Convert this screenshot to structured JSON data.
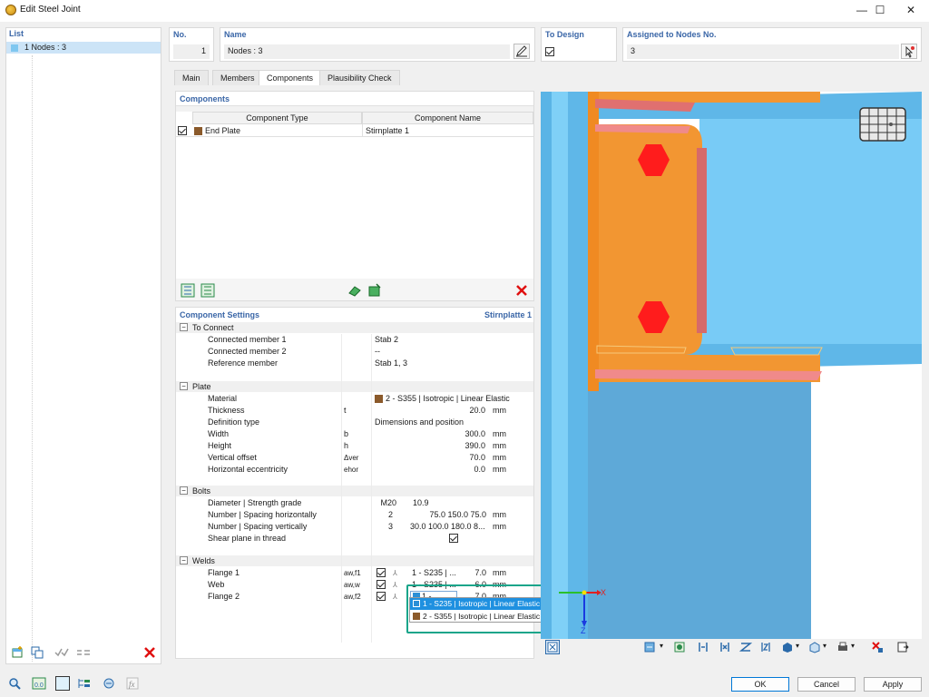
{
  "window": {
    "title": "Edit Steel Joint",
    "controls": {
      "minimize": "—",
      "maximize": "☐",
      "close": "✕"
    }
  },
  "list": {
    "header": "List",
    "items": [
      {
        "label": "1  Nodes : 3"
      }
    ]
  },
  "header": {
    "no_label": "No.",
    "no_value": "1",
    "name_label": "Name",
    "name_value": "Nodes : 3",
    "to_design_label": "To Design",
    "to_design_checked": true,
    "assigned_label": "Assigned to Nodes No.",
    "assigned_value": "3"
  },
  "tabs": [
    {
      "label": "Main",
      "active": false
    },
    {
      "label": "Members",
      "active": false
    },
    {
      "label": "Components",
      "active": true
    },
    {
      "label": "Plausibility Check",
      "active": false
    }
  ],
  "components": {
    "section_title": "Components",
    "col_type": "Component Type",
    "col_name": "Component Name",
    "rows": [
      {
        "checked": true,
        "type": "End Plate",
        "name": "Stirnplatte 1",
        "color": "#8b5a2b"
      }
    ]
  },
  "settings": {
    "section_title": "Component Settings",
    "component_name": "Stirnplatte 1",
    "groups": {
      "to_connect": {
        "title": "To Connect",
        "rows": [
          {
            "label": "Connected member 1",
            "sym": "",
            "value": "Stab 2",
            "unit": ""
          },
          {
            "label": "Connected member 2",
            "sym": "",
            "value": "--",
            "unit": ""
          },
          {
            "label": "Reference member",
            "sym": "",
            "value": "Stab 1, 3",
            "unit": ""
          }
        ]
      },
      "plate": {
        "title": "Plate",
        "rows": [
          {
            "label": "Material",
            "sym": "",
            "value": "2 - S355 | Isotropic | Linear Elastic",
            "unit": ""
          },
          {
            "label": "Thickness",
            "sym": "t",
            "value": "20.0",
            "unit": "mm"
          },
          {
            "label": "Definition type",
            "sym": "",
            "value": "Dimensions and position",
            "unit": ""
          },
          {
            "label": "Width",
            "sym": "b",
            "value": "300.0",
            "unit": "mm"
          },
          {
            "label": "Height",
            "sym": "h",
            "value": "390.0",
            "unit": "mm"
          },
          {
            "label": "Vertical offset",
            "sym": "Δver",
            "value": "70.0",
            "unit": "mm"
          },
          {
            "label": "Horizontal eccentricity",
            "sym": "ehor",
            "value": "0.0",
            "unit": "mm"
          }
        ]
      },
      "bolts": {
        "title": "Bolts",
        "rows": [
          {
            "label": "Diameter | Strength grade",
            "v1": "M20",
            "v2": "10.9",
            "unit": ""
          },
          {
            "label": "Number | Spacing horizontally",
            "v1": "2",
            "v2": "75.0 150.0 75.0",
            "unit": "mm"
          },
          {
            "label": "Number | Spacing vertically",
            "v1": "3",
            "v2": "30.0 100.0 180.0 8...",
            "unit": "mm"
          },
          {
            "label": "Shear plane in thread",
            "v1": "",
            "v2": "",
            "unit": ""
          }
        ]
      },
      "welds": {
        "title": "Welds",
        "rows": [
          {
            "label": "Flange 1",
            "sym": "aw,f1",
            "material": "1 - S235 | ...",
            "value": "7.0",
            "unit": "mm"
          },
          {
            "label": "Web",
            "sym": "aw,w",
            "material": "1 - S235 | ...",
            "value": "6.0",
            "unit": "mm"
          },
          {
            "label": "Flange 2",
            "sym": "aw,f2",
            "material": "1 - ...",
            "value": "7.0",
            "unit": "mm"
          }
        ]
      }
    }
  },
  "dropdown": {
    "options": [
      {
        "label": "1 - S235 | Isotropic | Linear Elastic",
        "selected": true,
        "color": "#2b8fd6"
      },
      {
        "label": "2 - S355 | Isotropic | Linear Elastic",
        "selected": false,
        "color": "#8b5a2b"
      }
    ]
  },
  "view": {
    "axis_x": "X",
    "axis_z": "Z"
  },
  "footer": {
    "ok": "OK",
    "cancel": "Cancel",
    "apply": "Apply"
  },
  "colors": {
    "accent": "#3a66a7",
    "highlight": "#1aa58a",
    "steel_blue": "#6fc8f2",
    "plate_orange": "#f29632",
    "bolt_red": "#ff1c1c"
  }
}
